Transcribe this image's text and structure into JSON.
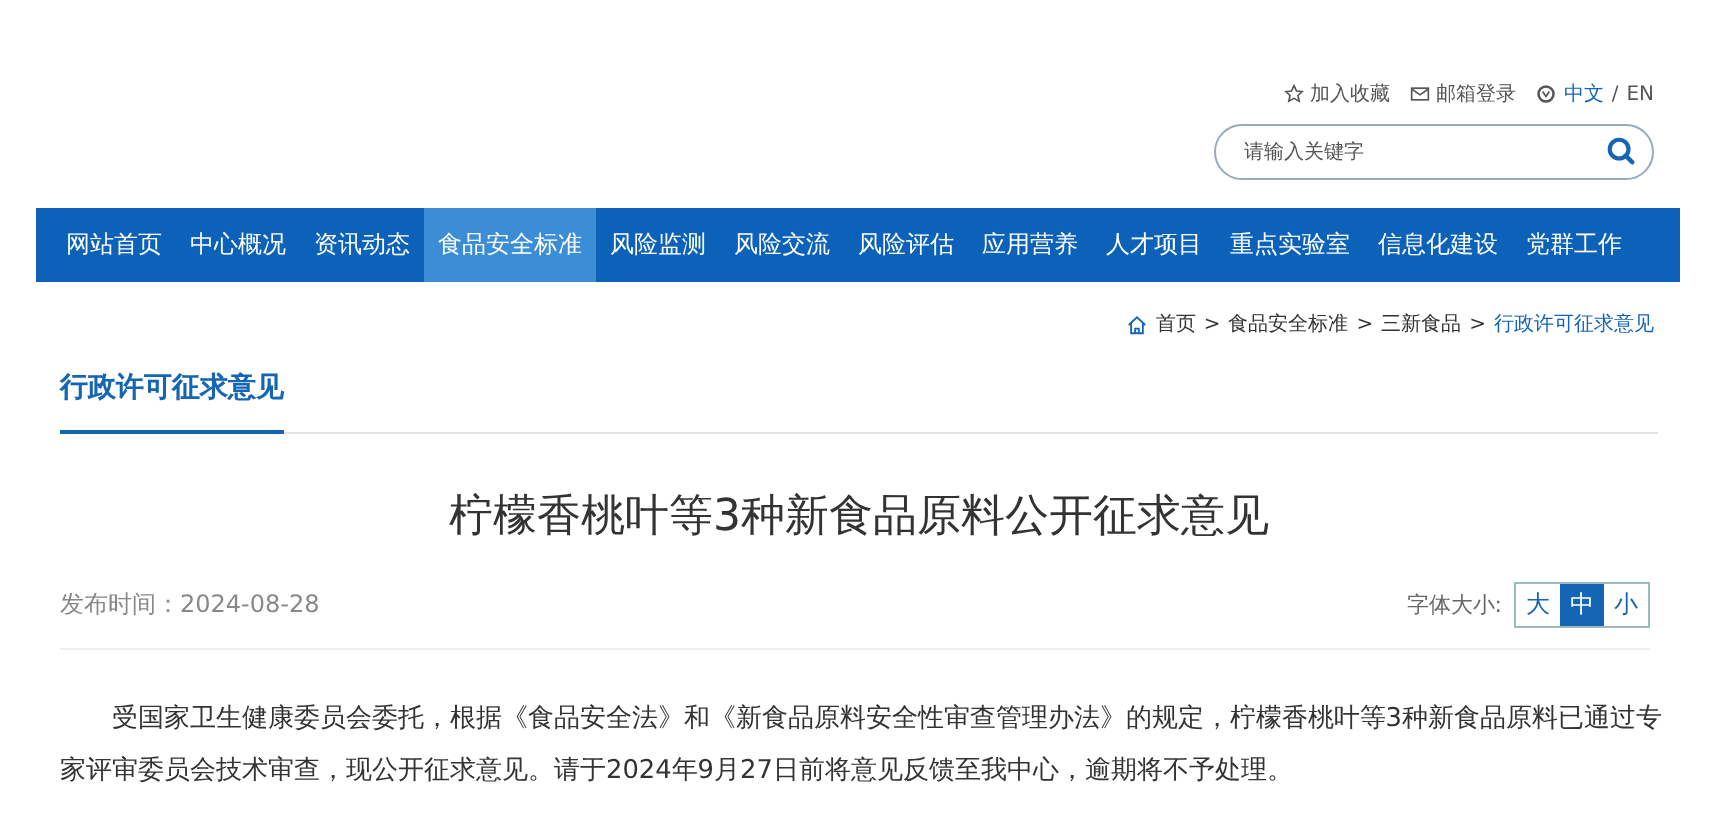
{
  "top_links": [
    {
      "kind": "star",
      "label": "加入收藏"
    },
    {
      "kind": "mail",
      "label": "邮箱登录"
    }
  ],
  "language": {
    "current": "中文",
    "separator": "/",
    "other": "EN"
  },
  "search": {
    "placeholder": "请输入关键字"
  },
  "nav": [
    {
      "label": "网站首页",
      "selected": false
    },
    {
      "label": "中心概况",
      "selected": false
    },
    {
      "label": "资讯动态",
      "selected": false
    },
    {
      "label": "食品安全标准",
      "selected": true
    },
    {
      "label": "风险监测",
      "selected": false
    },
    {
      "label": "风险交流",
      "selected": false
    },
    {
      "label": "风险评估",
      "selected": false
    },
    {
      "label": "应用营养",
      "selected": false
    },
    {
      "label": "人才项目",
      "selected": false
    },
    {
      "label": "重点实验室",
      "selected": false
    },
    {
      "label": "信息化建设",
      "selected": false
    },
    {
      "label": "党群工作",
      "selected": false
    }
  ],
  "breadcrumb": [
    "首页",
    "食品安全标准",
    "三新食品",
    "行政许可征求意见"
  ],
  "breadcrumb_separator": ">",
  "section_title": "行政许可征求意见",
  "article": {
    "title": "柠檬香桃叶等3种新食品原料公开征求意见",
    "published": "发布时间：2024-08-28",
    "font_size_label": "字体大小:",
    "font_sizes": [
      {
        "label": "大",
        "selected": false
      },
      {
        "label": "中",
        "selected": true
      },
      {
        "label": "小",
        "selected": false
      }
    ],
    "body": "受国家卫生健康委员会委托，根据《食品安全法》和《新食品原料安全性审查管理办法》的规定，柠檬香桃叶等3种新食品原料已通过专家评审委员会技术审查，现公开征求意见。请于2024年9月27日前将意见反馈至我中心，逾期将不予处理。"
  }
}
